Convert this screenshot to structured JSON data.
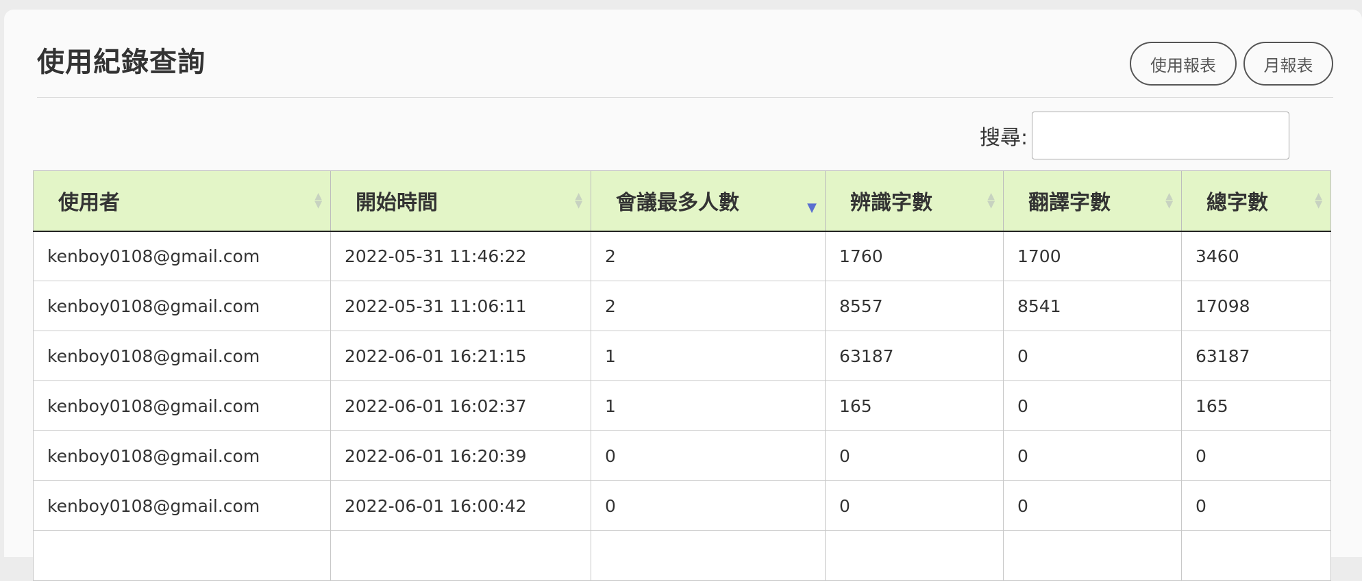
{
  "page": {
    "title": "使用紀錄查詢"
  },
  "toolbar": {
    "usage_report_label": "使用報表",
    "monthly_report_label": "月報表"
  },
  "search": {
    "label": "搜尋:",
    "value": "",
    "placeholder": ""
  },
  "table": {
    "columns": [
      {
        "label": "使用者",
        "sort": "none"
      },
      {
        "label": "開始時間",
        "sort": "none"
      },
      {
        "label": "會議最多人數",
        "sort": "desc"
      },
      {
        "label": "辨識字數",
        "sort": "none"
      },
      {
        "label": "翻譯字數",
        "sort": "none"
      },
      {
        "label": "總字數",
        "sort": "none"
      }
    ],
    "rows": [
      [
        "kenboy0108@gmail.com",
        "2022-05-31 11:46:22",
        "2",
        "1760",
        "1700",
        "3460"
      ],
      [
        "kenboy0108@gmail.com",
        "2022-05-31 11:06:11",
        "2",
        "8557",
        "8541",
        "17098"
      ],
      [
        "kenboy0108@gmail.com",
        "2022-06-01 16:21:15",
        "1",
        "63187",
        "0",
        "63187"
      ],
      [
        "kenboy0108@gmail.com",
        "2022-06-01 16:02:37",
        "1",
        "165",
        "0",
        "165"
      ],
      [
        "kenboy0108@gmail.com",
        "2022-06-01 16:20:39",
        "0",
        "0",
        "0",
        "0"
      ],
      [
        "kenboy0108@gmail.com",
        "2022-06-01 16:00:42",
        "0",
        "0",
        "0",
        "0"
      ],
      [
        "",
        "",
        "",
        "",
        "",
        ""
      ]
    ]
  },
  "colors": {
    "header_bg": "#e3f5c7",
    "sort_active": "#5a6fd0",
    "sort_inactive": "#c7d2c0"
  }
}
